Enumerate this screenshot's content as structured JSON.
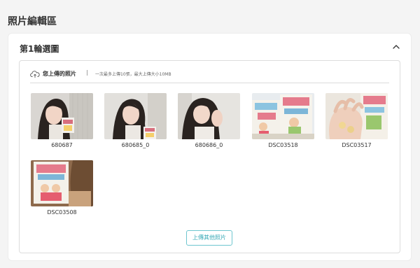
{
  "page": {
    "title": "照片編輯區"
  },
  "round": {
    "title": "第1輪選圖"
  },
  "upload_panel": {
    "title": "您上傳的照片",
    "separator": "|",
    "hint": "一次最多上傳10張，最大上傳大小10MB",
    "icon": "cloud-upload-icon"
  },
  "photos": [
    {
      "name": "680687",
      "kind": "selfie"
    },
    {
      "name": "680685_0",
      "kind": "selfie"
    },
    {
      "name": "680686_0",
      "kind": "selfie"
    },
    {
      "name": "DSC03518",
      "kind": "product"
    },
    {
      "name": "DSC03517",
      "kind": "hand"
    },
    {
      "name": "DSC03508",
      "kind": "product"
    }
  ],
  "actions": {
    "upload_more": "上傳其他照片"
  },
  "colors": {
    "accent": "#3aaab7",
    "accent_border": "#6ec6cf",
    "background": "#f4f4f4"
  }
}
